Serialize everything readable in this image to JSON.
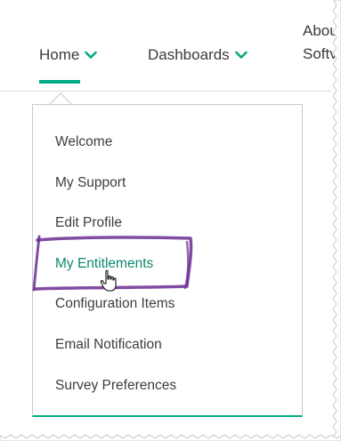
{
  "nav": {
    "home_label": "Home",
    "dashboards_label": "Dashboards",
    "about_line1": "Abou",
    "about_line2": "Softv",
    "accent_color": "#01a982"
  },
  "dropdown": {
    "items": [
      {
        "label": "Welcome"
      },
      {
        "label": "My Support"
      },
      {
        "label": "Edit Profile"
      },
      {
        "label": "My Entitlements",
        "active": true
      },
      {
        "label": "Configuration Items"
      },
      {
        "label": "Email Notification"
      },
      {
        "label": "Survey Preferences"
      }
    ]
  },
  "icons": {
    "nav_chevron": "chevron-down-icon",
    "pointer": "hand-pointer-icon"
  },
  "annotation": {
    "color": "#6b2d91"
  }
}
